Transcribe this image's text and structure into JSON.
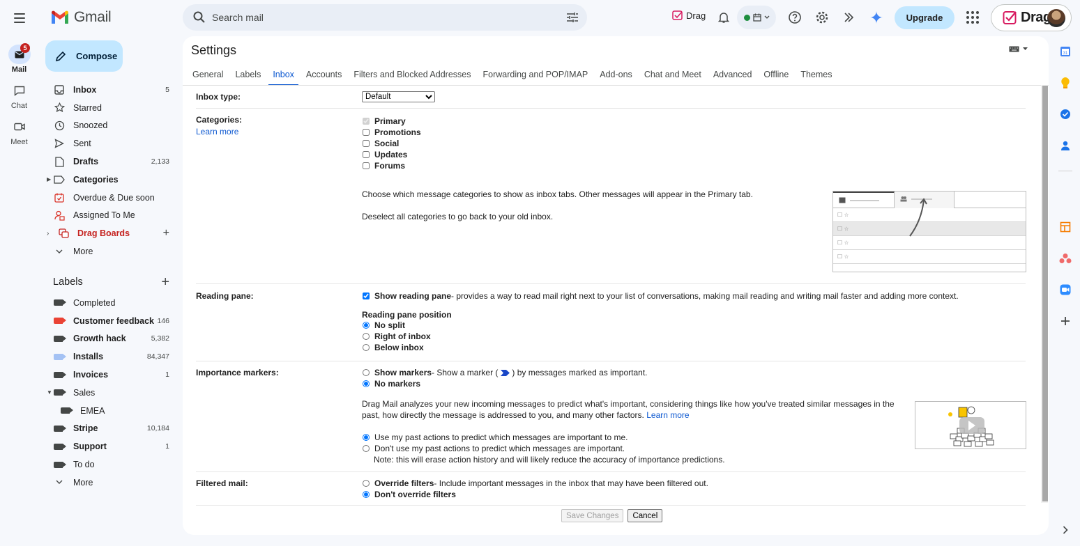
{
  "app": {
    "name": "Gmail"
  },
  "search": {
    "placeholder": "Search mail"
  },
  "topbar": {
    "drag_link": "Drag",
    "upgrade": "Upgrade",
    "drag_badge": "Drag"
  },
  "rail": [
    {
      "label": "Mail",
      "badge": "5",
      "icon": "mail-icon"
    },
    {
      "label": "Chat",
      "icon": "chat-icon"
    },
    {
      "label": "Meet",
      "icon": "meet-icon"
    }
  ],
  "compose": {
    "label": "Compose"
  },
  "nav": [
    {
      "label": "Inbox",
      "count": "5",
      "icon": "inbox-icon",
      "bold": true
    },
    {
      "label": "Starred",
      "count": "",
      "icon": "star-icon"
    },
    {
      "label": "Snoozed",
      "count": "",
      "icon": "clock-icon"
    },
    {
      "label": "Sent",
      "count": "",
      "icon": "send-icon"
    },
    {
      "label": "Drafts",
      "count": "2,133",
      "icon": "draft-icon",
      "bold": true
    },
    {
      "label": "Categories",
      "count": "",
      "icon": "label-icon",
      "bold": true
    },
    {
      "label": "Overdue & Due soon",
      "count": "",
      "icon": "calendar-alert-icon"
    },
    {
      "label": "Assigned To Me",
      "count": "",
      "icon": "assigned-icon"
    },
    {
      "label": "Drag Boards",
      "count": "",
      "icon": "drag-boards-icon"
    },
    {
      "label": "More",
      "count": "",
      "icon": "chevron-down-icon"
    }
  ],
  "labels": {
    "heading": "Labels",
    "items": [
      {
        "label": "Completed",
        "count": "",
        "color": "#444746"
      },
      {
        "label": "Customer feedback",
        "count": "146",
        "color": "#ea4335",
        "bold": true
      },
      {
        "label": "Growth hack",
        "count": "5,382",
        "color": "#444746",
        "bold": true
      },
      {
        "label": "Installs",
        "count": "84,347",
        "color": "#a4c2f4",
        "bold": true
      },
      {
        "label": "Invoices",
        "count": "1",
        "color": "#444746",
        "bold": true
      },
      {
        "label": "Sales",
        "count": "",
        "color": "#444746"
      },
      {
        "label": "EMEA",
        "count": "",
        "color": "#444746"
      },
      {
        "label": "Stripe",
        "count": "10,184",
        "color": "#444746",
        "bold": true
      },
      {
        "label": "Support",
        "count": "1",
        "color": "#444746",
        "bold": true
      },
      {
        "label": "To do",
        "count": "",
        "color": "#444746"
      },
      {
        "label": "More",
        "count": "",
        "color": "#444746"
      }
    ]
  },
  "settings": {
    "title": "Settings",
    "tabs": [
      "General",
      "Labels",
      "Inbox",
      "Accounts",
      "Filters and Blocked Addresses",
      "Forwarding and POP/IMAP",
      "Add-ons",
      "Chat and Meet",
      "Advanced",
      "Offline",
      "Themes"
    ],
    "active_tab": "Inbox",
    "inbox_type": {
      "label": "Inbox type:",
      "value": "Default"
    },
    "categories": {
      "label": "Categories:",
      "learn_more": "Learn more",
      "options": [
        "Primary",
        "Promotions",
        "Social",
        "Updates",
        "Forums"
      ],
      "desc1": "Choose which message categories to show as inbox tabs. Other messages will appear in the Primary tab.",
      "desc2": "Deselect all categories to go back to your old inbox."
    },
    "reading_pane": {
      "label": "Reading pane:",
      "show_label": "Show reading pane",
      "show_desc": " - provides a way to read mail right next to your list of conversations, making mail reading and writing mail faster and adding more context.",
      "position_heading": "Reading pane position",
      "positions": [
        "No split",
        "Right of inbox",
        "Below inbox"
      ]
    },
    "importance": {
      "label": "Importance markers:",
      "show_label": "Show markers",
      "show_desc_a": " - Show a marker (",
      "show_desc_b": ") by messages marked as important.",
      "no_markers": "No markers",
      "desc": "Drag Mail analyzes your new incoming messages to predict what's important, considering things like how you've treated similar messages in the past, how directly the message is addressed to you, and many other factors.",
      "learn_more": "Learn more",
      "use_past": "Use my past actions to predict which messages are important to me.",
      "dont_use_past": "Don't use my past actions to predict which messages are important.",
      "note": "Note: this will erase action history and will likely reduce the accuracy of importance predictions."
    },
    "filtered": {
      "label": "Filtered mail:",
      "override_label": "Override filters",
      "override_desc": " - Include important messages in the inbox that may have been filtered out.",
      "dont_override": "Don't override filters"
    },
    "buttons": {
      "save": "Save Changes",
      "cancel": "Cancel"
    }
  },
  "colors": {
    "accent": "#0b57d0",
    "compose_bg": "#c2e7ff",
    "badge_red": "#c5221f",
    "page_bg": "#f6f8fc"
  }
}
